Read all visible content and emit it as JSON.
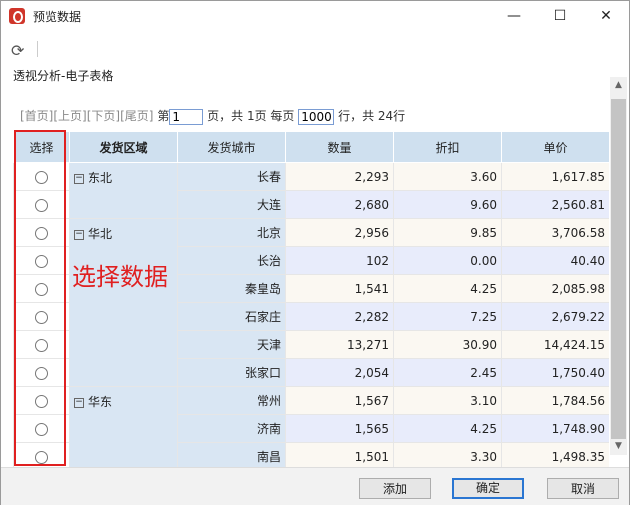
{
  "window": {
    "title": "预览数据",
    "minimize": "—",
    "maximize": "☐",
    "close": "✕"
  },
  "toolbar": {
    "refresh_icon": "refresh-icon"
  },
  "subtitle": "透视分析-电子表格",
  "pager": {
    "first": "[首页]",
    "prev": "[上页]",
    "next": "[下页]",
    "last": "[尾页]",
    "page_prefix": "第",
    "page_value": "1",
    "page_suffix": "页，共 1页 每页",
    "per_page_value": "1000",
    "row_suffix": "行，共 24行"
  },
  "table": {
    "headers": [
      "选择",
      "发货区域",
      "发货城市",
      "数量",
      "折扣",
      "单价"
    ],
    "rows": [
      {
        "region": "东北",
        "city": "长春",
        "qty": "2,293",
        "discount": "3.60",
        "price": "1,617.85"
      },
      {
        "region": "",
        "city": "大连",
        "qty": "2,680",
        "discount": "9.60",
        "price": "2,560.81"
      },
      {
        "region": "华北",
        "city": "北京",
        "qty": "2,956",
        "discount": "9.85",
        "price": "3,706.58"
      },
      {
        "region": "",
        "city": "长治",
        "qty": "102",
        "discount": "0.00",
        "price": "40.40"
      },
      {
        "region": "",
        "city": "秦皇岛",
        "qty": "1,541",
        "discount": "4.25",
        "price": "2,085.98"
      },
      {
        "region": "",
        "city": "石家庄",
        "qty": "2,282",
        "discount": "7.25",
        "price": "2,679.22"
      },
      {
        "region": "",
        "city": "天津",
        "qty": "13,271",
        "discount": "30.90",
        "price": "14,424.15"
      },
      {
        "region": "",
        "city": "张家口",
        "qty": "2,054",
        "discount": "2.45",
        "price": "1,750.40"
      },
      {
        "region": "华东",
        "city": "常州",
        "qty": "1,567",
        "discount": "3.10",
        "price": "1,784.56"
      },
      {
        "region": "",
        "city": "济南",
        "qty": "1,565",
        "discount": "4.25",
        "price": "1,748.90"
      },
      {
        "region": "",
        "city": "南昌",
        "qty": "1,501",
        "discount": "3.30",
        "price": "1,498.35"
      }
    ]
  },
  "annotation": "选择数据",
  "buttons": {
    "add": "添加",
    "ok": "确定",
    "cancel": "取消"
  },
  "colors": {
    "highlight": "#e02020",
    "header": "#cfe0ef",
    "accent": "#2a76d2"
  }
}
